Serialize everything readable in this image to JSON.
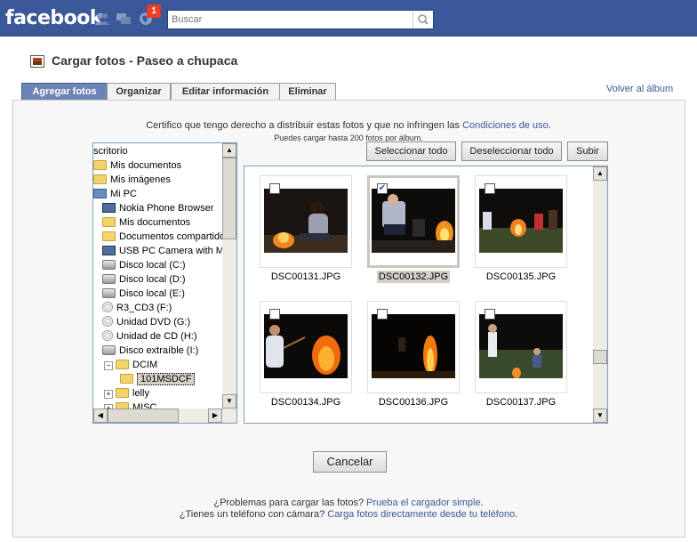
{
  "topbar": {
    "logo": "facebook",
    "notification_count": "1",
    "search_placeholder": "Buscar"
  },
  "header": {
    "title": "Cargar fotos - Paseo a chupaca",
    "back_link": "Volver al álbum"
  },
  "tabs": [
    {
      "label": "Agregar fotos",
      "active": true
    },
    {
      "label": "Organizar",
      "active": false
    },
    {
      "label": "Editar información",
      "active": false
    },
    {
      "label": "Eliminar",
      "active": false
    }
  ],
  "notice": {
    "text": "Certifico que tengo derecho a distribuir estas fotos y que no infringen las ",
    "link": "Condiciones de uso",
    "end": ".",
    "limit": "Puedes cargar hasta 200 fotos por álbum."
  },
  "toolbar": {
    "select_all": "Seleccionar todo",
    "deselect_all": "Deseleccionar todo",
    "upload": "Subir"
  },
  "tree": [
    {
      "label": "scritorio",
      "icon": "none",
      "indent": 0
    },
    {
      "label": "Mis documentos",
      "icon": "folder",
      "indent": 0
    },
    {
      "label": "Mis imágenes",
      "icon": "folder",
      "indent": 0
    },
    {
      "label": "Mi PC",
      "icon": "computer",
      "indent": 0
    },
    {
      "label": "Nokia Phone Browser",
      "icon": "phone",
      "indent": 1
    },
    {
      "label": "Mis documentos",
      "icon": "folder",
      "indent": 1
    },
    {
      "label": "Documentos compartidos",
      "icon": "folder",
      "indent": 1
    },
    {
      "label": "USB PC Camera with Mic",
      "icon": "camera",
      "indent": 1
    },
    {
      "label": "Disco local (C:)",
      "icon": "drive",
      "indent": 1
    },
    {
      "label": "Disco local (D:)",
      "icon": "drive",
      "indent": 1
    },
    {
      "label": "Disco local (E:)",
      "icon": "drive",
      "indent": 1
    },
    {
      "label": "R3_CD3 (F:)",
      "icon": "disc",
      "indent": 1
    },
    {
      "label": "Unidad DVD (G:)",
      "icon": "disc",
      "indent": 1
    },
    {
      "label": "Unidad de CD (H:)",
      "icon": "disc",
      "indent": 1
    },
    {
      "label": "Disco extraíble (I:)",
      "icon": "drive",
      "indent": 1
    },
    {
      "label": "DCIM",
      "icon": "folder-open",
      "indent": 2,
      "expander": "−"
    },
    {
      "label": "101MSDCF",
      "icon": "folder",
      "indent": 3,
      "selected": true
    },
    {
      "label": "lelly",
      "icon": "folder",
      "indent": 2,
      "expander": "+"
    },
    {
      "label": "MISC",
      "icon": "folder",
      "indent": 2,
      "expander": "+"
    }
  ],
  "photos": [
    {
      "name": "DSC00131.JPG",
      "checked": false,
      "selected": false
    },
    {
      "name": "DSC00132.JPG",
      "checked": true,
      "selected": true
    },
    {
      "name": "DSC00135.JPG",
      "checked": false,
      "selected": false
    },
    {
      "name": "DSC00134.JPG",
      "checked": false,
      "selected": false
    },
    {
      "name": "DSC00136.JPG",
      "checked": false,
      "selected": false
    },
    {
      "name": "DSC00137.JPG",
      "checked": false,
      "selected": false
    }
  ],
  "cancel_label": "Cancelar",
  "footer": {
    "problems_text": "¿Problemas para cargar las fotos? ",
    "problems_link": "Prueba el cargador simple",
    "problems_end": ".",
    "phone_text": "¿Tienes un teléfono con cámara? ",
    "phone_link": "Carga fotos directamente desde tu teléfono",
    "phone_end": "."
  },
  "colors": {
    "brand": "#3b5998",
    "tab_active": "#6d84b4",
    "badge": "#f03d25"
  }
}
